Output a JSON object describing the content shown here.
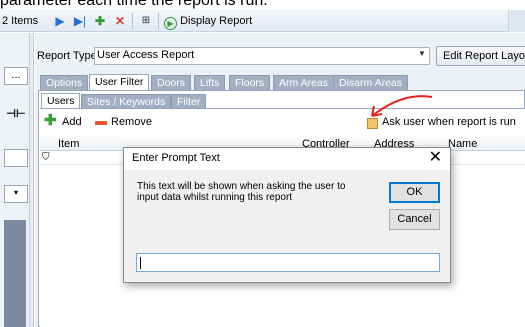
{
  "caption": "parameter each time the report is run.",
  "toolbar": {
    "items_label": "2 Items",
    "display_report": "Display Report"
  },
  "left_panel": {
    "box1": "...",
    "box2": "⊣⊢",
    "box3": "▾"
  },
  "report": {
    "type_label": "Report Type",
    "type_value": "User Access Report",
    "edit_button": "Edit Report Layout"
  },
  "tabs_primary": [
    "Options",
    "User Filter",
    "Doors",
    "Lifts",
    "Floors",
    "Arm Areas",
    "Disarm Areas"
  ],
  "tabs_secondary": [
    "Users",
    "Sites / Keywords",
    "Filter"
  ],
  "actions": {
    "add": "Add",
    "remove": "Remove",
    "ask_user": "Ask user when report is run"
  },
  "grid": {
    "columns": [
      "Item",
      "Controller",
      "Address",
      "Name"
    ]
  },
  "dialog": {
    "title": "Enter Prompt Text",
    "message": "This text will be shown when asking the user to input data whilst running this report",
    "ok": "OK",
    "cancel": "Cancel",
    "input_value": ""
  },
  "colors": {
    "toolbar_bg": "#e3e9f2",
    "tab_inactive": "#a2afc2",
    "annotation_red": "#e8201c",
    "checkbox_orange": "#f3c36c"
  }
}
